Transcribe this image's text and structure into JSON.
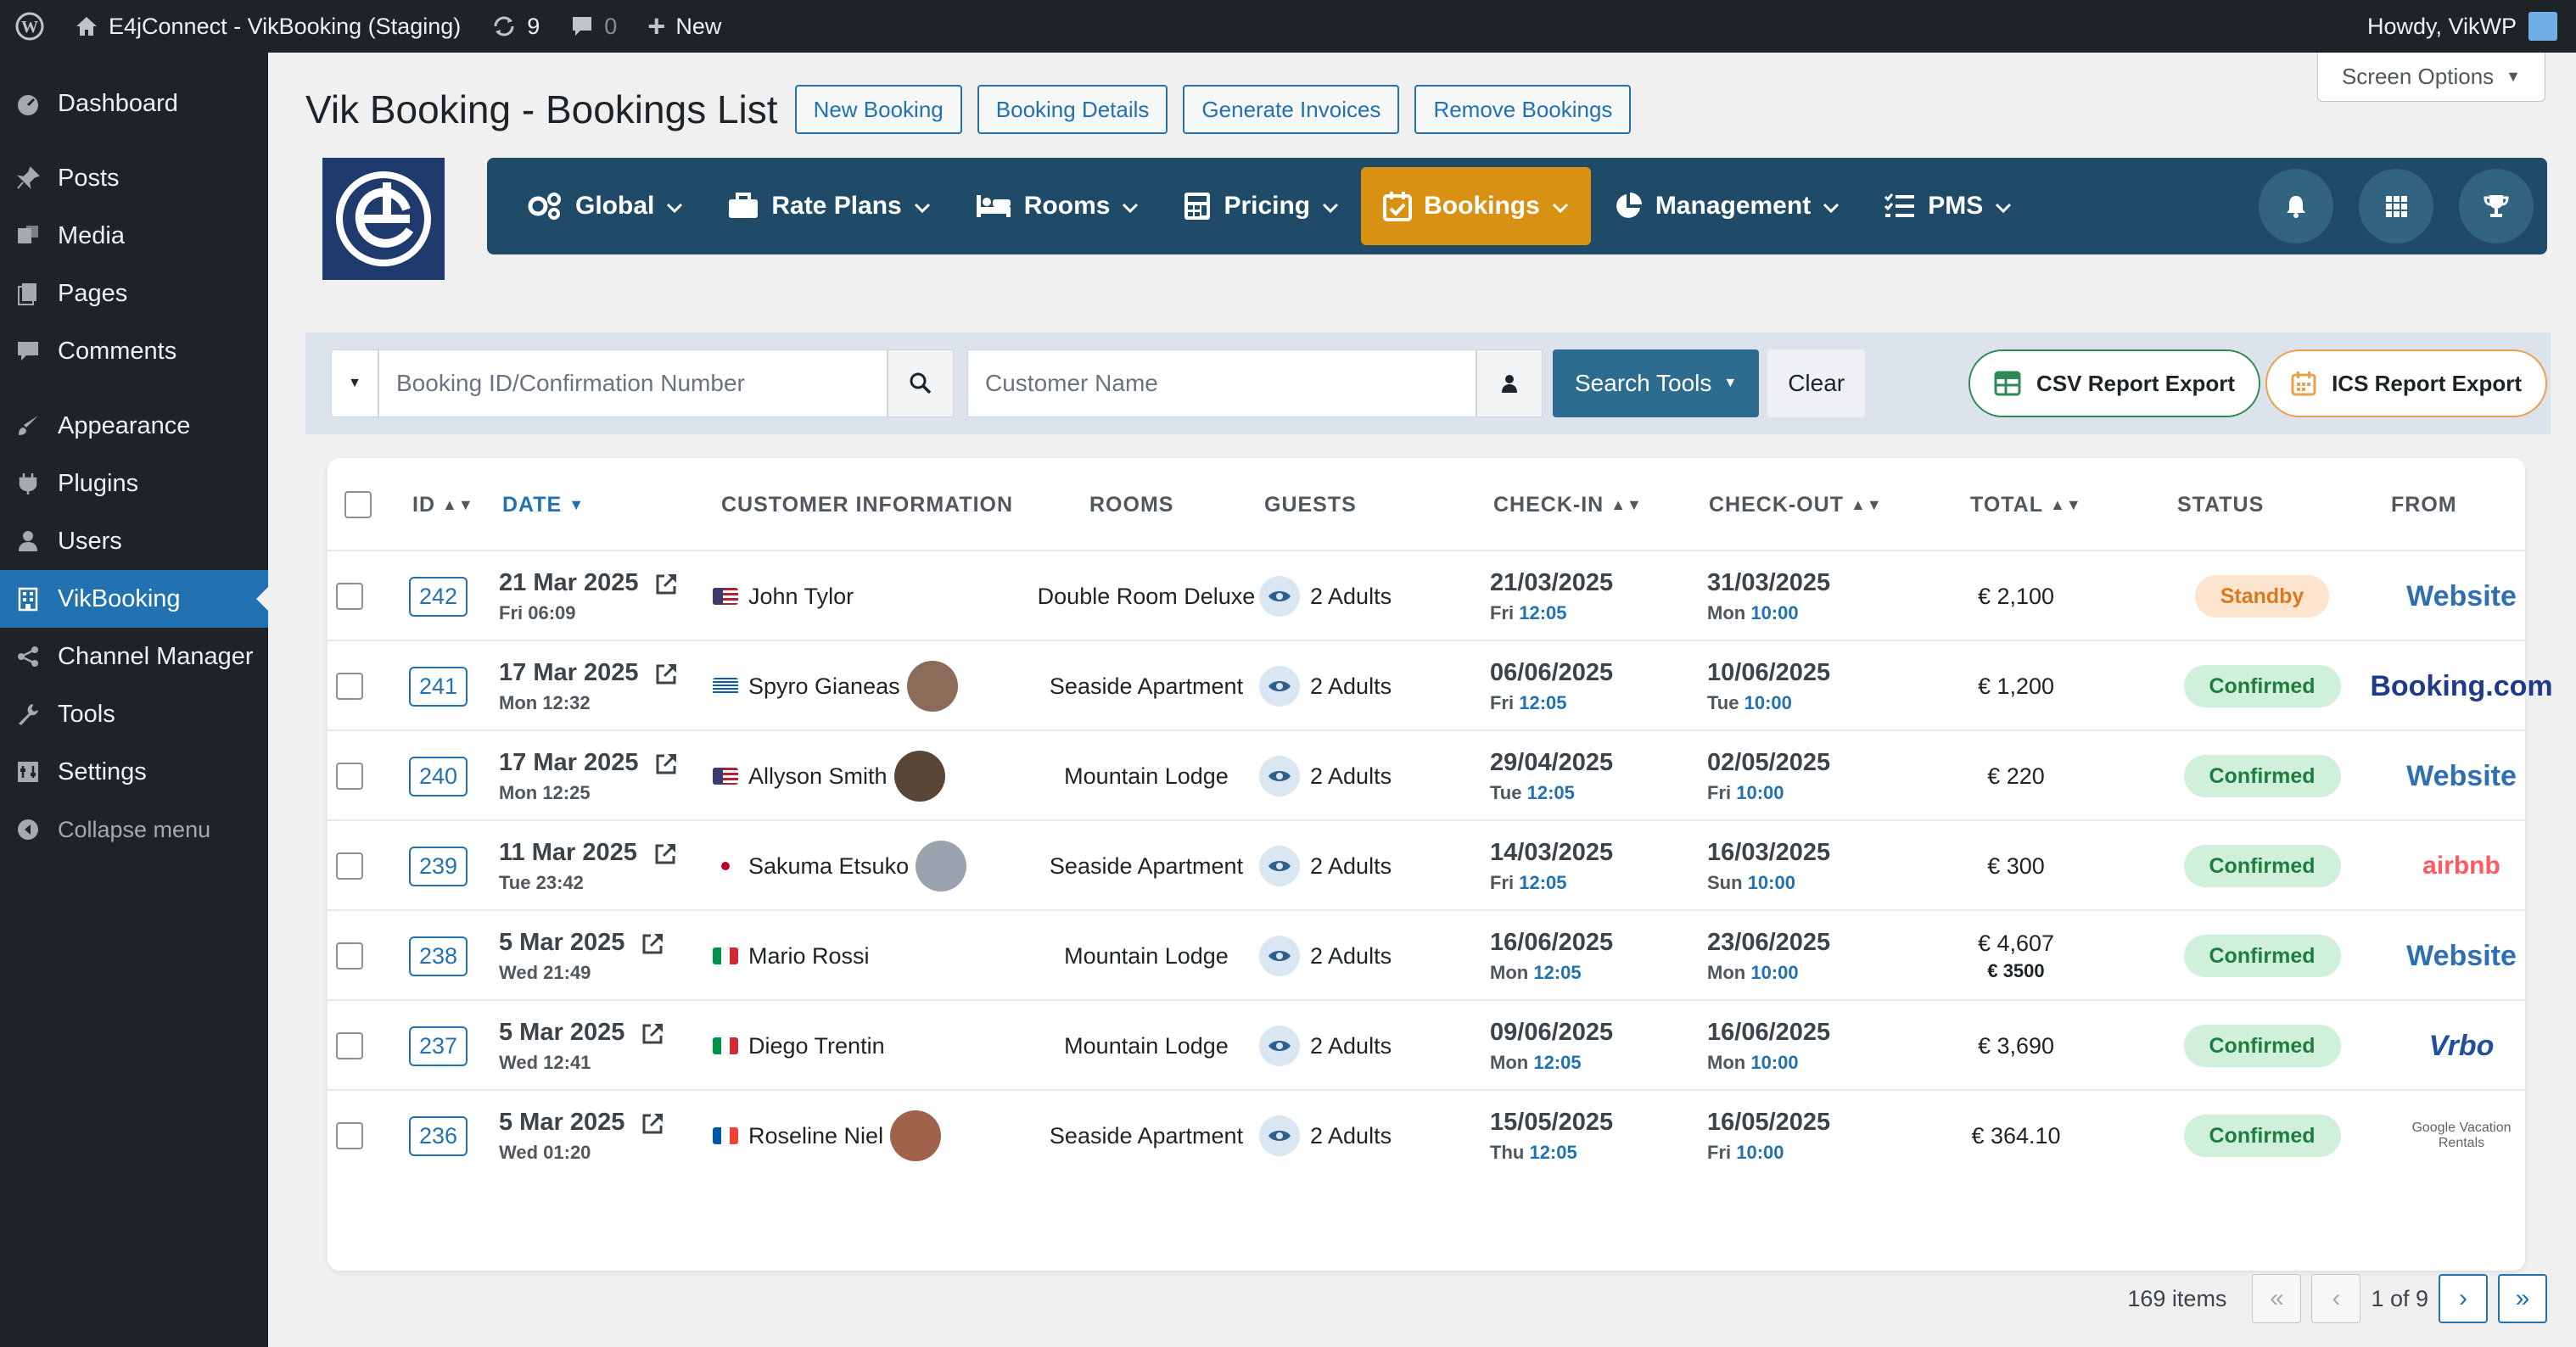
{
  "adminbar": {
    "site": "E4jConnect - VikBooking (Staging)",
    "updates": "9",
    "comments": "0",
    "new": "New",
    "howdy": "Howdy, VikWP"
  },
  "sidebar": {
    "items": [
      {
        "label": "Dashboard",
        "icon": "dashboard-icon"
      },
      {
        "label": "Posts",
        "icon": "pin-icon"
      },
      {
        "label": "Media",
        "icon": "media-icon"
      },
      {
        "label": "Pages",
        "icon": "page-icon"
      },
      {
        "label": "Comments",
        "icon": "comment-icon"
      },
      {
        "label": "Appearance",
        "icon": "brush-icon"
      },
      {
        "label": "Plugins",
        "icon": "plugin-icon"
      },
      {
        "label": "Users",
        "icon": "user-icon"
      },
      {
        "label": "VikBooking",
        "icon": "building-icon"
      },
      {
        "label": "Channel Manager",
        "icon": "share-icon"
      },
      {
        "label": "Tools",
        "icon": "wrench-icon"
      },
      {
        "label": "Settings",
        "icon": "settings-icon"
      }
    ],
    "collapse": "Collapse menu"
  },
  "screen_options": "Screen Options",
  "header": {
    "title": "Vik Booking - Bookings List",
    "buttons": [
      "New Booking",
      "Booking Details",
      "Generate Invoices",
      "Remove Bookings"
    ]
  },
  "nav": [
    "Global",
    "Rate Plans",
    "Rooms",
    "Pricing",
    "Bookings",
    "Management",
    "PMS"
  ],
  "filters": {
    "booking_placeholder": "Booking ID/Confirmation Number",
    "customer_placeholder": "Customer Name",
    "search_tools": "Search Tools",
    "clear": "Clear",
    "csv": "CSV Report Export",
    "ics": "ICS Report Export"
  },
  "table": {
    "headers": {
      "id": "ID",
      "date": "DATE",
      "customer": "CUSTOMER INFORMATION",
      "rooms": "ROOMS",
      "guests": "GUESTS",
      "checkin": "CHECK-IN",
      "checkout": "CHECK-OUT",
      "total": "TOTAL",
      "status": "STATUS",
      "from": "FROM"
    },
    "rows": [
      {
        "id": "242",
        "date": "21 Mar 2025",
        "date_sub": "Fri 06:09",
        "customer": "John Tylor",
        "flag": "us",
        "avatar": false,
        "room": "Double Room Deluxe",
        "guests": "2 Adults",
        "ci": "21/03/2025",
        "ci_day": "Fri",
        "ci_time": "12:05",
        "co": "31/03/2025",
        "co_day": "Mon",
        "co_time": "10:00",
        "total": "€ 2,100",
        "total2": "",
        "status": "Standby",
        "from": "Website"
      },
      {
        "id": "241",
        "date": "17 Mar 2025",
        "date_sub": "Mon 12:32",
        "customer": "Spyro Gianeas",
        "flag": "gr",
        "avatar": true,
        "room": "Seaside Apartment",
        "guests": "2 Adults",
        "ci": "06/06/2025",
        "ci_day": "Fri",
        "ci_time": "12:05",
        "co": "10/06/2025",
        "co_day": "Tue",
        "co_time": "10:00",
        "total": "€ 1,200",
        "total2": "",
        "status": "Confirmed",
        "from": "Booking.com"
      },
      {
        "id": "240",
        "date": "17 Mar 2025",
        "date_sub": "Mon 12:25",
        "customer": "Allyson Smith",
        "flag": "us",
        "avatar": true,
        "room": "Mountain Lodge",
        "guests": "2 Adults",
        "ci": "29/04/2025",
        "ci_day": "Tue",
        "ci_time": "12:05",
        "co": "02/05/2025",
        "co_day": "Fri",
        "co_time": "10:00",
        "total": "€ 220",
        "total2": "",
        "status": "Confirmed",
        "from": "Website"
      },
      {
        "id": "239",
        "date": "11 Mar 2025",
        "date_sub": "Tue 23:42",
        "customer": "Sakuma Etsuko",
        "flag": "jp",
        "avatar": true,
        "room": "Seaside Apartment",
        "guests": "2 Adults",
        "ci": "14/03/2025",
        "ci_day": "Fri",
        "ci_time": "12:05",
        "co": "16/03/2025",
        "co_day": "Sun",
        "co_time": "10:00",
        "total": "€ 300",
        "total2": "",
        "status": "Confirmed",
        "from": "airbnb"
      },
      {
        "id": "238",
        "date": "5 Mar 2025",
        "date_sub": "Wed 21:49",
        "customer": "Mario Rossi",
        "flag": "it",
        "avatar": false,
        "room": "Mountain Lodge",
        "guests": "2 Adults",
        "ci": "16/06/2025",
        "ci_day": "Mon",
        "ci_time": "12:05",
        "co": "23/06/2025",
        "co_day": "Mon",
        "co_time": "10:00",
        "total": "€ 4,607",
        "total2": "€ 3500",
        "status": "Confirmed",
        "from": "Website"
      },
      {
        "id": "237",
        "date": "5 Mar 2025",
        "date_sub": "Wed 12:41",
        "customer": "Diego Trentin",
        "flag": "it",
        "avatar": false,
        "room": "Mountain Lodge",
        "guests": "2 Adults",
        "ci": "09/06/2025",
        "ci_day": "Mon",
        "ci_time": "12:05",
        "co": "16/06/2025",
        "co_day": "Mon",
        "co_time": "10:00",
        "total": "€ 3,690",
        "total2": "",
        "status": "Confirmed",
        "from": "Vrbo"
      },
      {
        "id": "236",
        "date": "5 Mar 2025",
        "date_sub": "Wed 01:20",
        "customer": "Roseline Niel",
        "flag": "fr",
        "avatar": true,
        "room": "Seaside Apartment",
        "guests": "2 Adults",
        "ci": "15/05/2025",
        "ci_day": "Thu",
        "ci_time": "12:05",
        "co": "16/05/2025",
        "co_day": "Fri",
        "co_time": "10:00",
        "total": "€ 364.10",
        "total2": "",
        "status": "Confirmed",
        "from": "Google Vacation Rentals"
      }
    ]
  },
  "pagination": {
    "items": "169 items",
    "page": "1 of 9"
  }
}
